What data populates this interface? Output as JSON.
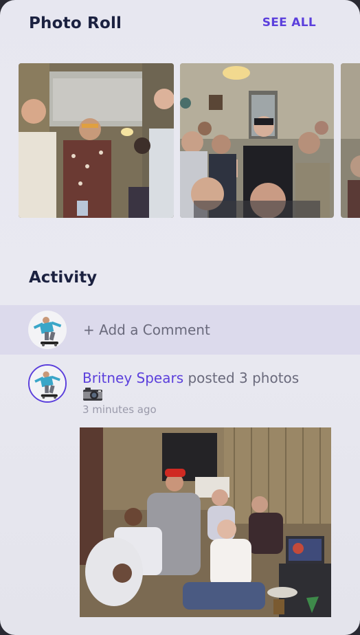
{
  "photo_roll": {
    "title": "Photo Roll",
    "see_all_label": "SEE ALL",
    "photos": [
      "party-photo-1",
      "party-photo-2",
      "party-photo-3"
    ]
  },
  "activity": {
    "title": "Activity",
    "comment_placeholder": "+ Add a Comment",
    "post": {
      "author": "Britney Spears",
      "action": " posted 3 photos",
      "emoji": "camera-icon",
      "timestamp": "3 minutes ago"
    }
  },
  "colors": {
    "accent": "#5b3fdc",
    "heading": "#1b2140",
    "muted_text": "#6a6a7c",
    "timestamp_text": "#9a9aaa",
    "background": "#e7e7f0",
    "comment_row_bg": "#dcdaec"
  }
}
